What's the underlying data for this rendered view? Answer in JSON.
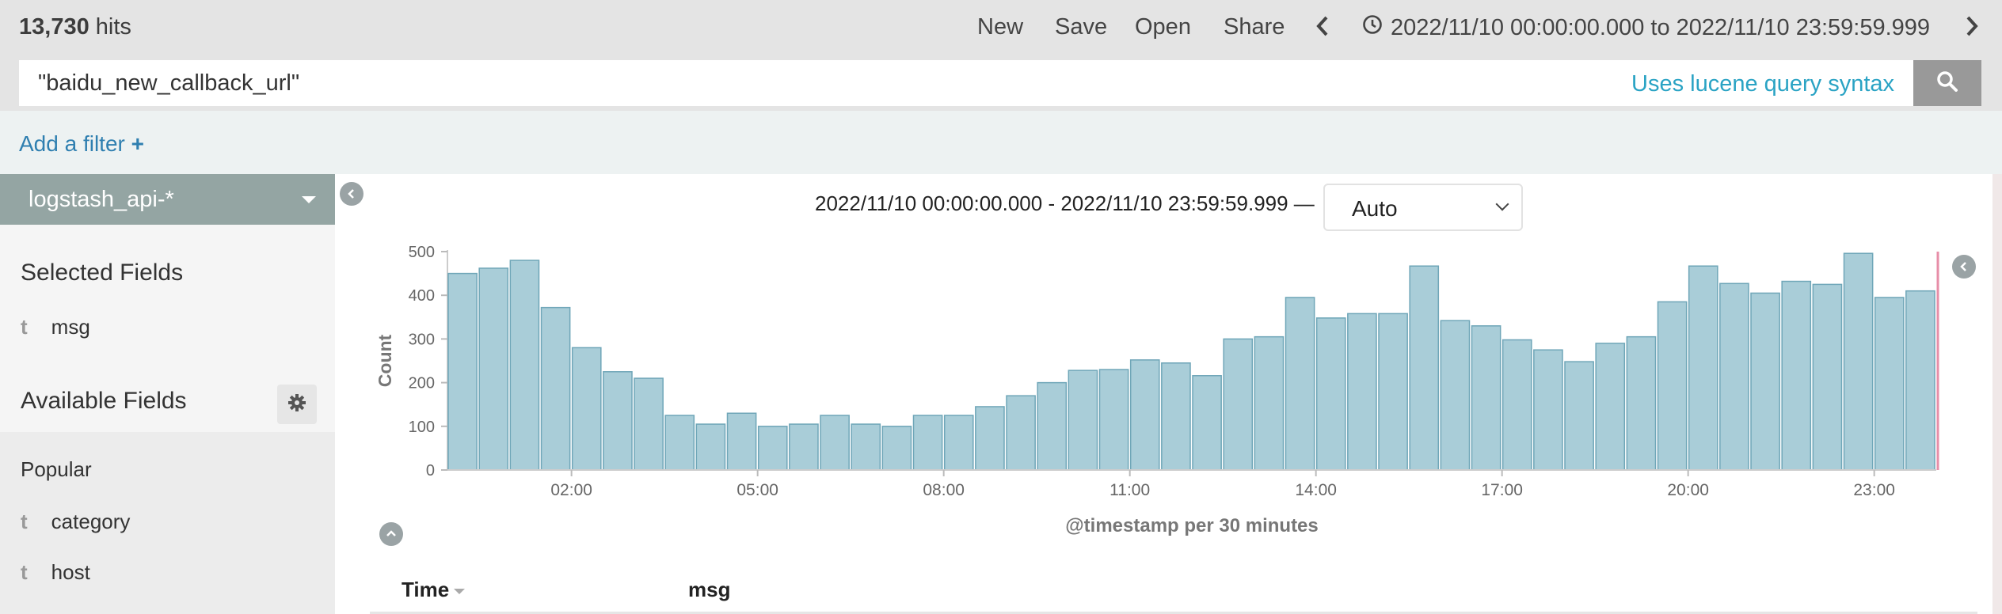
{
  "header": {
    "hits_count": "13,730",
    "hits_label": " hits",
    "menu": [
      {
        "label": "New"
      },
      {
        "label": "Save"
      },
      {
        "label": "Open"
      },
      {
        "label": "Share"
      }
    ],
    "time_range": "2022/11/10 00:00:00.000 to 2022/11/10 23:59:59.999"
  },
  "query": {
    "value": "\"baidu_new_callback_url\"",
    "syntax_link": "Uses lucene query syntax"
  },
  "filter": {
    "add_label": "Add a filter",
    "add_icon": "+"
  },
  "sidebar": {
    "index_pattern": "logstash_api-*",
    "selected_title": "Selected Fields",
    "selected_fields": [
      {
        "type": "t",
        "name": "msg"
      }
    ],
    "available_title": "Available Fields",
    "popular_title": "Popular",
    "available_fields": [
      {
        "type": "t",
        "name": "category"
      },
      {
        "type": "t",
        "name": "host"
      }
    ]
  },
  "main": {
    "range_label": "2022/11/10 00:00:00.000 - 2022/11/10 23:59:59.999 —",
    "interval": "Auto",
    "table_columns": [
      {
        "label": "Time"
      },
      {
        "label": "msg"
      }
    ]
  },
  "colors": {
    "bar_fill": "#a9cdd8",
    "bar_stroke": "#6fa6b8",
    "now_line": "#e78ea8",
    "link": "#2aa3c4"
  },
  "chart_data": {
    "type": "bar",
    "x_start_hours": 0,
    "bucket_minutes": 30,
    "values": [
      450,
      462,
      480,
      372,
      280,
      225,
      210,
      125,
      105,
      130,
      100,
      105,
      125,
      105,
      100,
      125,
      125,
      145,
      170,
      200,
      228,
      230,
      252,
      245,
      216,
      300,
      305,
      395,
      348,
      358,
      358,
      467,
      342,
      330,
      298,
      275,
      248,
      290,
      305,
      385,
      467,
      427,
      405,
      432,
      425,
      496,
      395,
      410
    ],
    "xlabel": "@timestamp per 30 minutes",
    "ylabel": "Count",
    "ylim": [
      0,
      500
    ],
    "yticks": [
      0,
      100,
      200,
      300,
      400,
      500
    ],
    "xticks": [
      {
        "label": "02:00",
        "hour": 2
      },
      {
        "label": "05:00",
        "hour": 5
      },
      {
        "label": "08:00",
        "hour": 8
      },
      {
        "label": "11:00",
        "hour": 11
      },
      {
        "label": "14:00",
        "hour": 14
      },
      {
        "label": "17:00",
        "hour": 17
      },
      {
        "label": "20:00",
        "hour": 20
      },
      {
        "label": "23:00",
        "hour": 23
      }
    ]
  }
}
